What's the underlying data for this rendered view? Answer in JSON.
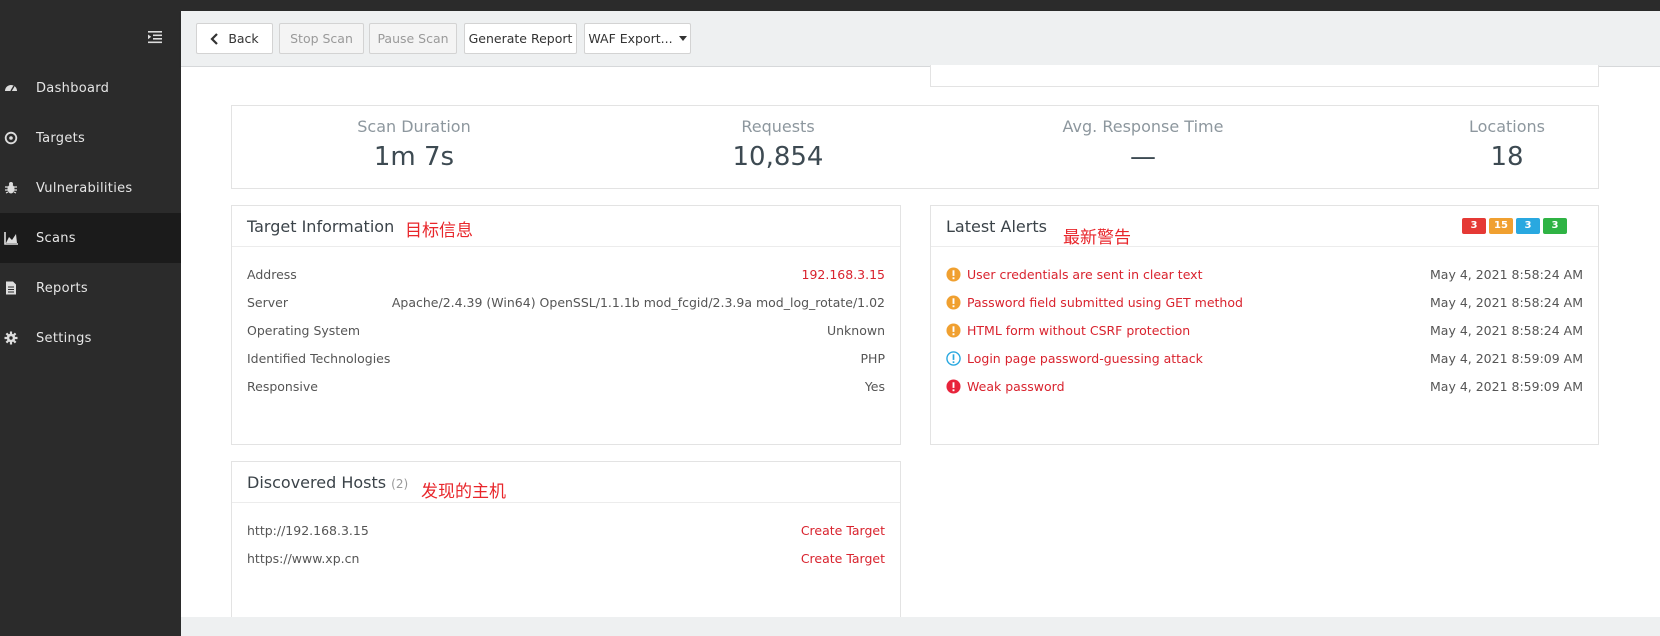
{
  "sidebar": {
    "items": [
      {
        "label": "Dashboard",
        "icon": "dashboard-icon"
      },
      {
        "label": "Targets",
        "icon": "target-icon"
      },
      {
        "label": "Vulnerabilities",
        "icon": "bug-icon"
      },
      {
        "label": "Scans",
        "icon": "chart-icon"
      },
      {
        "label": "Reports",
        "icon": "report-icon"
      },
      {
        "label": "Settings",
        "icon": "gear-icon"
      }
    ],
    "active": "Scans"
  },
  "toolbar": {
    "back_label": "Back",
    "stop_label": "Stop Scan",
    "pause_label": "Pause Scan",
    "report_label": "Generate Report",
    "waf_label": "WAF Export..."
  },
  "stats": {
    "duration_label": "Scan Duration",
    "duration_value": "1m 7s",
    "requests_label": "Requests",
    "requests_value": "10,854",
    "response_label": "Avg. Response Time",
    "response_value": "—",
    "locations_label": "Locations",
    "locations_value": "18"
  },
  "target_info": {
    "title": "Target Information",
    "annotation": "目标信息",
    "rows": [
      {
        "key": "Address",
        "value": "192.168.3.15"
      },
      {
        "key": "Server",
        "value": "Apache/2.4.39 (Win64) OpenSSL/1.1.1b mod_fcgid/2.3.9a mod_log_rotate/1.02"
      },
      {
        "key": "Operating System",
        "value": "Unknown"
      },
      {
        "key": "Identified Technologies",
        "value": "PHP"
      },
      {
        "key": "Responsive",
        "value": "Yes"
      }
    ]
  },
  "alerts": {
    "title": "Latest Alerts",
    "annotation": "最新警告",
    "badges": {
      "high": "3",
      "medium": "15",
      "low": "3",
      "info": "3"
    },
    "items": [
      {
        "text": "User credentials are sent in clear text",
        "time": "May 4, 2021 8:58:24 AM",
        "severity": "medium"
      },
      {
        "text": "Password field submitted using GET method",
        "time": "May 4, 2021 8:58:24 AM",
        "severity": "medium"
      },
      {
        "text": "HTML form without CSRF protection",
        "time": "May 4, 2021 8:58:24 AM",
        "severity": "medium"
      },
      {
        "text": "Login page password-guessing attack",
        "time": "May 4, 2021 8:59:09 AM",
        "severity": "low"
      },
      {
        "text": "Weak password",
        "time": "May 4, 2021 8:59:09 AM",
        "severity": "high"
      }
    ]
  },
  "hosts": {
    "title": "Discovered Hosts",
    "count": "(2)",
    "annotation": "发现的主机",
    "items": [
      {
        "url": "http://192.168.3.15",
        "action": "Create Target"
      },
      {
        "url": "https://www.xp.cn",
        "action": "Create Target"
      }
    ]
  },
  "colors": {
    "sidebar_bg": "#2b2b2b",
    "accent_red": "#d9232e",
    "badge_high": "#e53935",
    "badge_medium": "#f0a030",
    "badge_low": "#29a8e0",
    "badge_info": "#2fb344"
  }
}
